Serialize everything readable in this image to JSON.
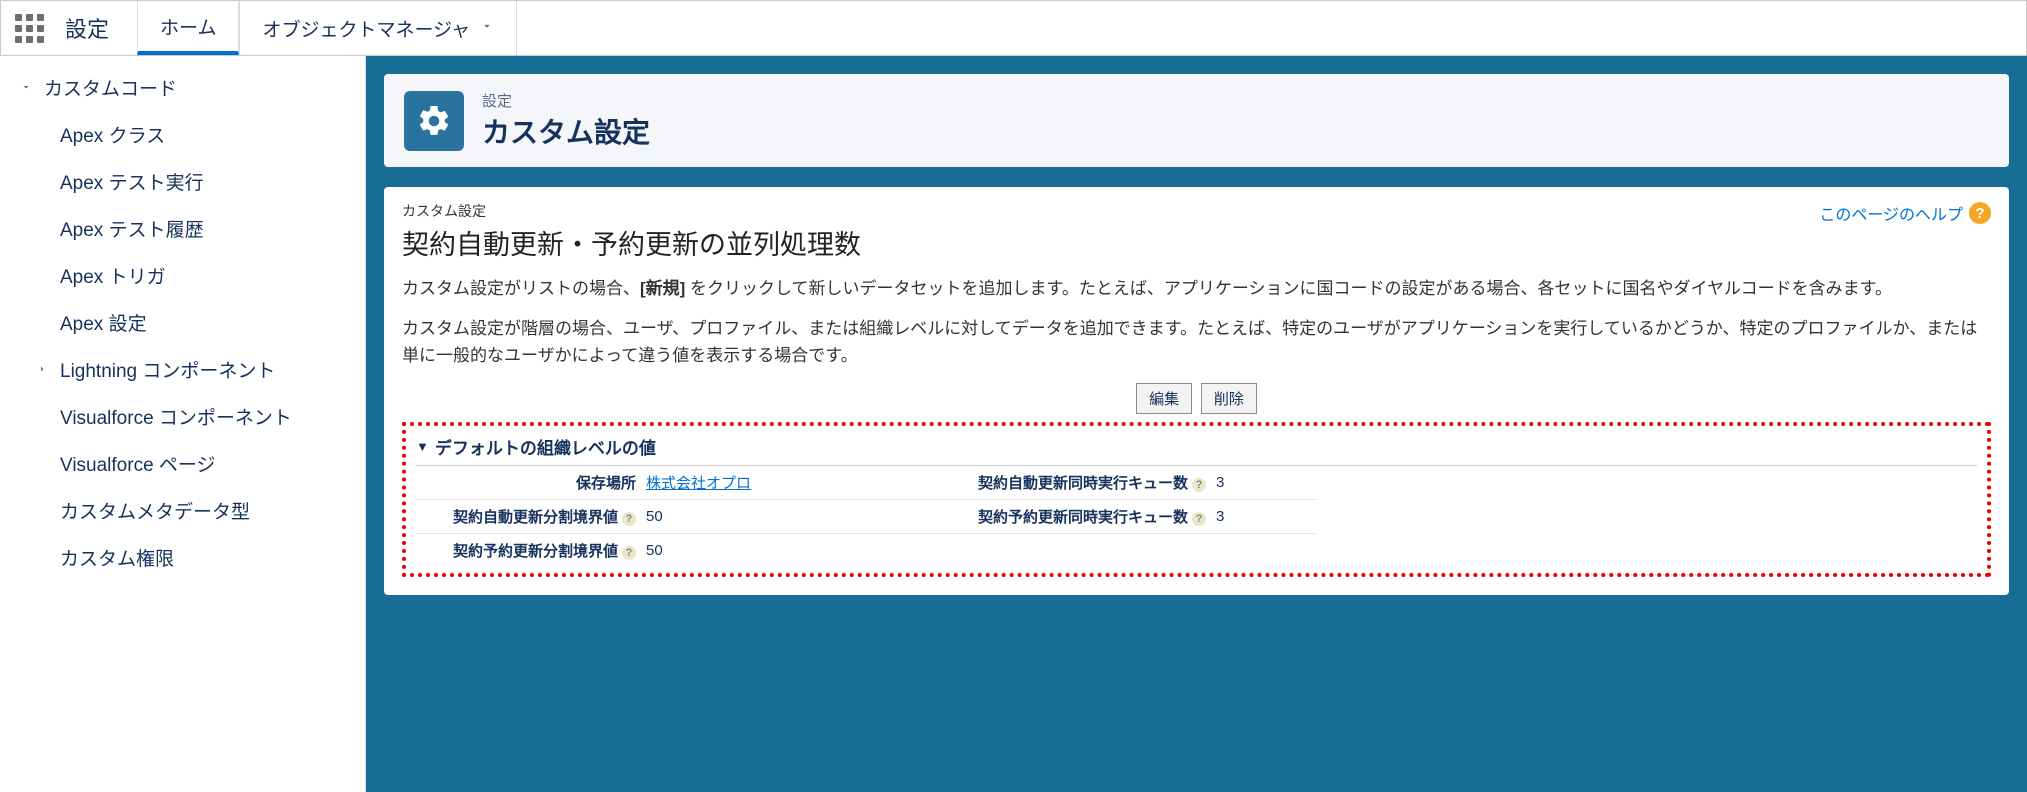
{
  "topbar": {
    "title": "設定",
    "tabs": [
      {
        "label": "ホーム",
        "active": true
      },
      {
        "label": "オブジェクトマネージャ",
        "active": false,
        "dropdown": true
      }
    ]
  },
  "sidebar": {
    "parent": "カスタムコード",
    "items": [
      "Apex クラス",
      "Apex テスト実行",
      "Apex テスト履歴",
      "Apex トリガ",
      "Apex 設定",
      "Lightning コンポーネント",
      "Visualforce コンポーネント",
      "Visualforce ページ",
      "カスタムメタデータ型",
      "カスタム権限"
    ],
    "expandable_index": 5
  },
  "header": {
    "eyebrow": "設定",
    "title": "カスタム設定"
  },
  "page": {
    "breadcrumb": "カスタム設定",
    "title": "契約自動更新・予約更新の並列処理数",
    "help_label": "このページのヘルプ",
    "desc1_pre": "カスタム設定がリストの場合、",
    "desc1_bold": "[新規]",
    "desc1_post": " をクリックして新しいデータセットを追加します。たとえば、アプリケーションに国コードの設定がある場合、各セットに国名やダイヤルコードを含みます。",
    "desc2": "カスタム設定が階層の場合、ユーザ、プロファイル、または組織レベルに対してデータを追加できます。たとえば、特定のユーザがアプリケーションを実行しているかどうか、特定のプロファイルか、または単に一般的なユーザかによって違う値を表示する場合です。",
    "buttons": {
      "edit": "編集",
      "delete": "削除"
    },
    "section_title": "デフォルトの組織レベルの値",
    "fields": {
      "location_label": "保存場所",
      "location_value": "株式会社オプロ",
      "auto_queue_label": "契約自動更新同時実行キュー数",
      "auto_queue_value": "3",
      "auto_split_label": "契約自動更新分割境界値",
      "auto_split_value": "50",
      "reserve_queue_label": "契約予約更新同時実行キュー数",
      "reserve_queue_value": "3",
      "reserve_split_label": "契約予約更新分割境界値",
      "reserve_split_value": "50"
    }
  }
}
